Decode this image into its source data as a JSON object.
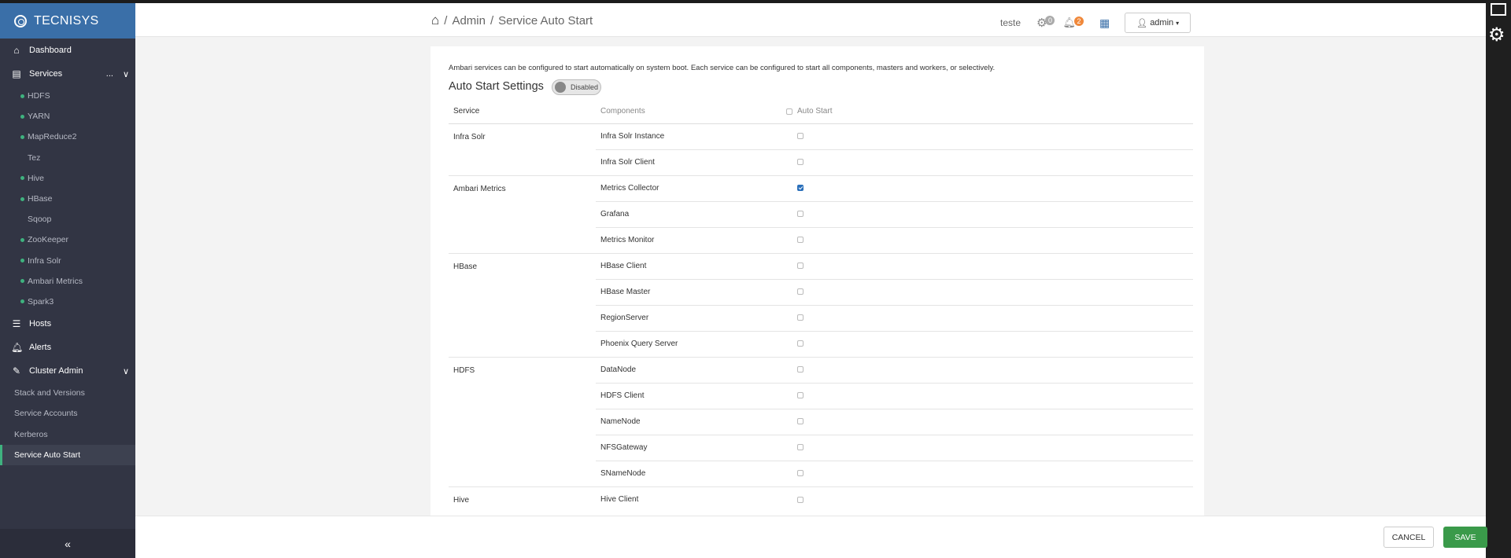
{
  "sidebar": {
    "brand": "TECNISYS",
    "dashboard": "Dashboard",
    "services": "Services",
    "services_more": "...",
    "service_items": [
      {
        "label": "HDFS",
        "dot": true
      },
      {
        "label": "YARN",
        "dot": true
      },
      {
        "label": "MapReduce2",
        "dot": true
      },
      {
        "label": "Tez",
        "dot": false
      },
      {
        "label": "Hive",
        "dot": true
      },
      {
        "label": "HBase",
        "dot": true
      },
      {
        "label": "Sqoop",
        "dot": false
      },
      {
        "label": "ZooKeeper",
        "dot": true
      },
      {
        "label": "Infra Solr",
        "dot": true
      },
      {
        "label": "Ambari Metrics",
        "dot": true
      },
      {
        "label": "Spark3",
        "dot": true
      }
    ],
    "hosts": "Hosts",
    "alerts": "Alerts",
    "cluster_admin": "Cluster Admin",
    "cluster_items": [
      "Stack and Versions",
      "Service Accounts",
      "Kerberos",
      "Service Auto Start"
    ],
    "collapse": "«"
  },
  "header": {
    "breadcrumb": [
      "Admin",
      "Service Auto Start"
    ],
    "separator": "/",
    "cluster_user": "teste",
    "ops_count": "0",
    "alerts_count": "2",
    "admin_label": "admin"
  },
  "main": {
    "description": "Ambari services can be configured to start automatically on system boot. Each service can be configured to start all components, masters and workers, or selectively.",
    "settings_title": "Auto Start Settings",
    "toggle_label": "Disabled",
    "columns": {
      "service": "Service",
      "components": "Components",
      "auto_start": "Auto Start"
    },
    "rows": [
      {
        "service": "Infra Solr",
        "component": "Infra Solr Instance",
        "checked": false
      },
      {
        "service": "",
        "component": "Infra Solr Client",
        "checked": false
      },
      {
        "service": "Ambari Metrics",
        "component": "Metrics Collector",
        "checked": true
      },
      {
        "service": "",
        "component": "Grafana",
        "checked": false
      },
      {
        "service": "",
        "component": "Metrics Monitor",
        "checked": false
      },
      {
        "service": "HBase",
        "component": "HBase Client",
        "checked": false
      },
      {
        "service": "",
        "component": "HBase Master",
        "checked": false
      },
      {
        "service": "",
        "component": "RegionServer",
        "checked": false
      },
      {
        "service": "",
        "component": "Phoenix Query Server",
        "checked": false
      },
      {
        "service": "HDFS",
        "component": "DataNode",
        "checked": false
      },
      {
        "service": "",
        "component": "HDFS Client",
        "checked": false
      },
      {
        "service": "",
        "component": "NameNode",
        "checked": false
      },
      {
        "service": "",
        "component": "NFSGateway",
        "checked": false
      },
      {
        "service": "",
        "component": "SNameNode",
        "checked": false
      },
      {
        "service": "Hive",
        "component": "Hive Client",
        "checked": false
      }
    ]
  },
  "footer": {
    "cancel": "CANCEL",
    "save": "SAVE"
  }
}
